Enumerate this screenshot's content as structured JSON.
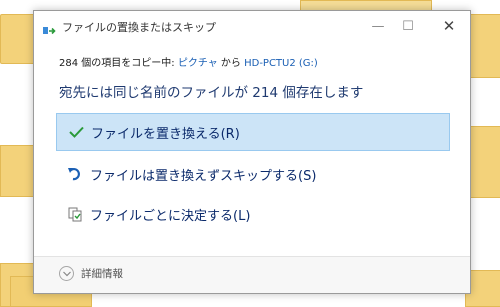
{
  "window": {
    "title": "ファイルの置換またはスキップ",
    "min_glyph": "—",
    "max_glyph": "☐",
    "close_glyph": "✕"
  },
  "copy_status": {
    "prefix": "284 個の項目をコピー中: ",
    "source": "ピクチャ",
    "middle": " から ",
    "destination": "HD-PCTU2 (G:)"
  },
  "message": "宛先には同じ名前のファイルが 214 個存在します",
  "options": [
    {
      "label": "ファイルを置き換える(R)",
      "icon": "check-icon",
      "selected": true
    },
    {
      "label": "ファイルは置き換えずスキップする(S)",
      "icon": "skip-arrow-icon",
      "selected": false
    },
    {
      "label": "ファイルごとに決定する(L)",
      "icon": "compare-files-icon",
      "selected": false
    }
  ],
  "footer": {
    "details_label": "詳細情報",
    "details_icon": "chevron-down-icon"
  },
  "colors": {
    "accent": "#1a5fb4",
    "selected_bg": "#cce4f7",
    "check_green": "#2a9a3a"
  }
}
